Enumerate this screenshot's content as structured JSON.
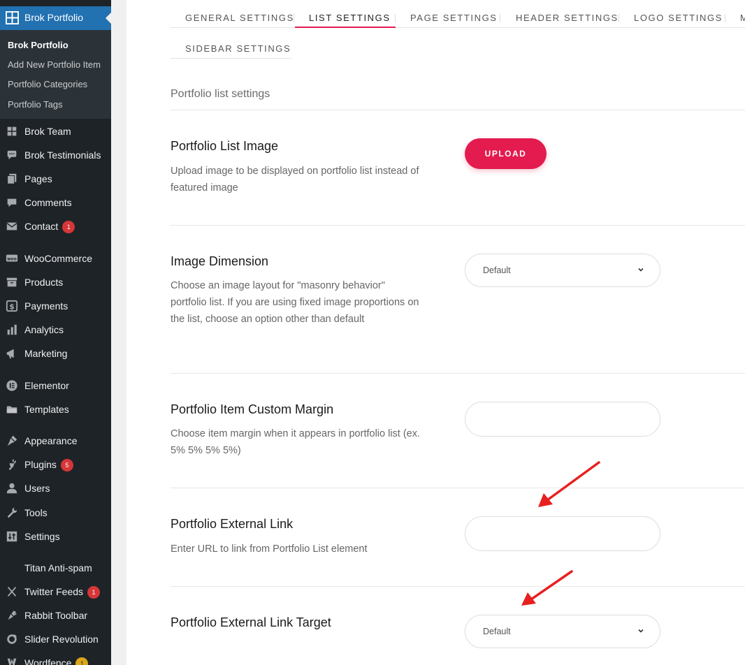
{
  "sidebar": {
    "active_menu": "Brok Portfolio",
    "submenu": [
      {
        "label": "Brok Portfolio",
        "current": true
      },
      {
        "label": "Add New Portfolio Item"
      },
      {
        "label": "Portfolio Categories"
      },
      {
        "label": "Portfolio Tags"
      }
    ],
    "items": [
      {
        "label": "Brok Team",
        "icon": "grid-icon"
      },
      {
        "label": "Brok Testimonials",
        "icon": "speech-bubble-icon"
      },
      {
        "label": "Pages",
        "icon": "pages-icon"
      },
      {
        "label": "Comments",
        "icon": "comment-icon"
      },
      {
        "label": "Contact",
        "icon": "mail-icon",
        "badge": "1"
      },
      {
        "label": "WooCommerce",
        "icon": "woo-icon"
      },
      {
        "label": "Products",
        "icon": "archive-icon"
      },
      {
        "label": "Payments",
        "icon": "dollar-icon"
      },
      {
        "label": "Analytics",
        "icon": "bar-chart-icon"
      },
      {
        "label": "Marketing",
        "icon": "megaphone-icon"
      },
      {
        "label": "Elementor",
        "icon": "elementor-icon"
      },
      {
        "label": "Templates",
        "icon": "folder-icon"
      },
      {
        "label": "Appearance",
        "icon": "brush-icon"
      },
      {
        "label": "Plugins",
        "icon": "plugin-icon",
        "badge": "5"
      },
      {
        "label": "Users",
        "icon": "user-icon"
      },
      {
        "label": "Tools",
        "icon": "wrench-icon"
      },
      {
        "label": "Settings",
        "icon": "sliders-icon"
      },
      {
        "label": "Titan Anti-spam",
        "icon": ""
      },
      {
        "label": "Twitter Feeds",
        "icon": "x-icon",
        "badge": "1"
      },
      {
        "label": "Rabbit Toolbar",
        "icon": "carrot-icon"
      },
      {
        "label": "Slider Revolution",
        "icon": "revolution-icon"
      },
      {
        "label": "Wordfence",
        "icon": "wordfence-icon",
        "badge": "1"
      }
    ]
  },
  "tabs": [
    {
      "label": "GENERAL SETTINGS"
    },
    {
      "label": "LIST SETTINGS",
      "active": true
    },
    {
      "label": "PAGE SETTINGS"
    },
    {
      "label": "HEADER SETTINGS"
    },
    {
      "label": "LOGO SETTINGS"
    },
    {
      "label": "M"
    },
    {
      "label": "SIDEBAR SETTINGS"
    }
  ],
  "section_title": "Portfolio list settings",
  "settings": [
    {
      "title": "Portfolio List Image",
      "description": "Upload image to be displayed on portfolio list instead of featured image",
      "control": "upload",
      "button_label": "UPLOAD"
    },
    {
      "title": "Image Dimension",
      "description": "Choose an image layout for \"masonry behavior\" portfolio list. If you are using fixed image proportions on the list, choose an option other than default",
      "control": "select",
      "value": "Default"
    },
    {
      "title": "Portfolio Item Custom Margin",
      "description": "Choose item margin when it appears in portfolio list (ex. 5% 5% 5% 5%)",
      "control": "text",
      "value": ""
    },
    {
      "title": "Portfolio External Link",
      "description": "Enter URL to link from Portfolio List element",
      "control": "text",
      "value": ""
    },
    {
      "title": "Portfolio External Link Target",
      "description": "",
      "control": "select",
      "value": "Default"
    }
  ],
  "colors": {
    "sidebar_bg": "#1d2327",
    "sidebar_active": "#2271b1",
    "accent": "#e31b4f",
    "annotation_arrow": "#e8201f",
    "badge": "#d63638"
  }
}
